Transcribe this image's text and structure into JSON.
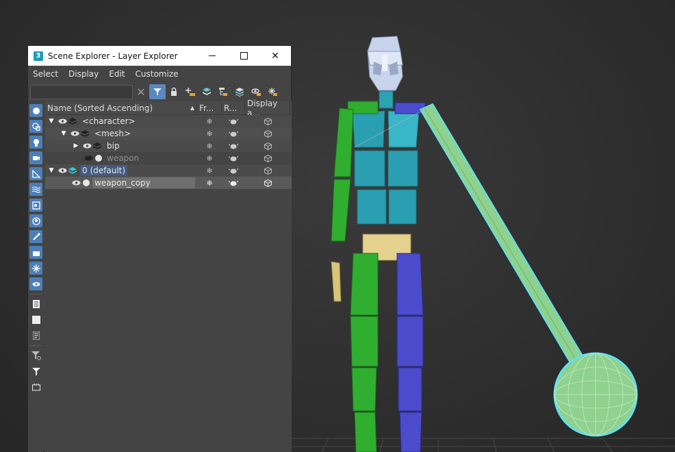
{
  "window": {
    "app_icon": "3",
    "title": "Scene Explorer - Layer Explorer",
    "controls": {
      "minimize": "minimize",
      "maximize": "maximize",
      "close": "✕"
    }
  },
  "menu": [
    "Select",
    "Display",
    "Edit",
    "Customize"
  ],
  "toolbar": {
    "search_value": "",
    "clear": "✕",
    "icons": [
      "filter-funnel-icon",
      "lock-icon",
      "add-layer-icon",
      "layers-icon",
      "hierarchy-icon",
      "stack-icon",
      "highlight-layer-icon",
      "freeze-layer-icon"
    ]
  },
  "columns": {
    "name": "Name (Sorted Ascending)",
    "sort": "▲",
    "frozen": "Fr...",
    "render": "R...",
    "display": "Display a..."
  },
  "rows": [
    {
      "label": "<character>"
    },
    {
      "label": "<mesh>"
    },
    {
      "label": "bip"
    },
    {
      "label": "weapon"
    },
    {
      "label": "0 (default)"
    },
    {
      "label": "weapon_copy"
    }
  ],
  "glyphs": {
    "expanded": "▼",
    "collapsed": "▶",
    "eye": "👁",
    "snowflake": "❄",
    "teapot": "☕",
    "cube": "⬡"
  },
  "left_tools": [
    "geometry-icon",
    "shapes-icon",
    "lights-icon",
    "cameras-icon",
    "helpers-icon",
    "spacewarps-icon",
    "groups-icon",
    "xrefs-icon",
    "bones-icon",
    "containers-icon",
    "frozen-icon",
    "hidden-icon",
    "list-icon",
    "square-icon",
    "doc-icon",
    "filter-cog-icon",
    "filter-icon",
    "frame-icon"
  ],
  "colors": {
    "selection_blue": "#455a80",
    "selection_gray": "#6f6f6f",
    "accent": "#5b88bc",
    "layer_cyan": "#35c2cf",
    "viewport_bg": "#2e2e2e"
  }
}
